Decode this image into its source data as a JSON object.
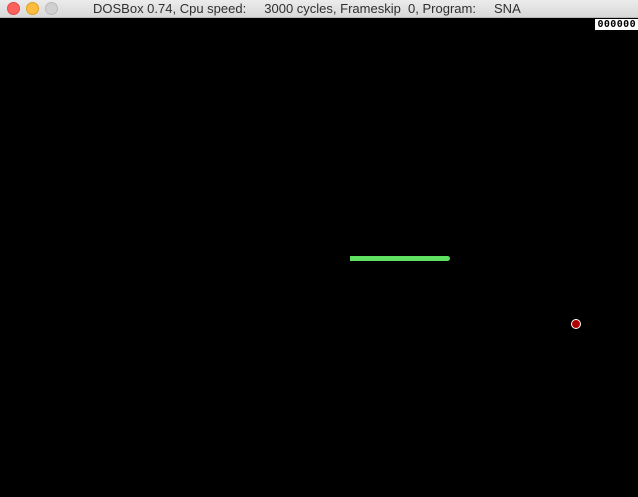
{
  "window": {
    "title": "DOSBox 0.74, Cpu speed:     3000 cycles, Frameskip  0, Program:     SNA"
  },
  "game": {
    "score": "000000",
    "colors": {
      "background": "#000000",
      "snake": "#5ee060",
      "food": "#b00000"
    }
  }
}
